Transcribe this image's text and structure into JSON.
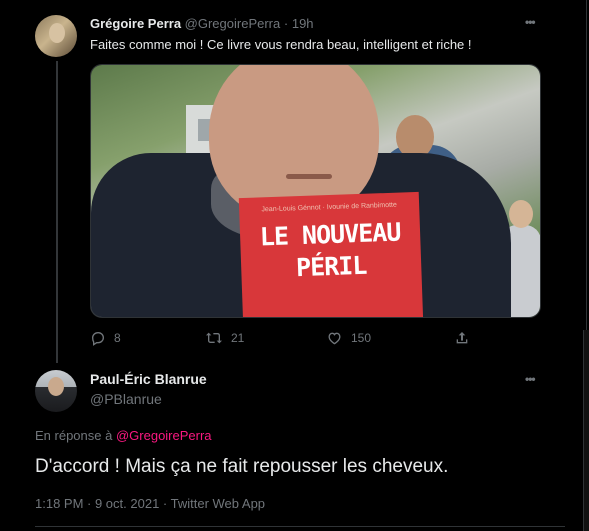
{
  "tweet1": {
    "author_name": "Grégoire Perra",
    "author_handle": "@GregoirePerra",
    "separator": "·",
    "time": "19h",
    "text": "Faites comme moi ! Ce livre vous rendra beau, intelligent et riche !",
    "media": {
      "book_authors": "Jean-Louis Génnot · Ivounie de Ranbimotte",
      "book_title": "LE NOUVEAU\nPÉRIL"
    },
    "actions": {
      "replies": "8",
      "retweets": "21",
      "likes": "150"
    }
  },
  "tweet2": {
    "author_name": "Paul-Éric Blanrue",
    "author_handle": "@PBlanrue",
    "reply_prefix": "En réponse à",
    "reply_to": "@GregoirePerra",
    "text": "D'accord ! Mais ça ne fait repousser les cheveux.",
    "meta": "1:18 PM · 9 oct. 2021 · Twitter Web App"
  },
  "icons": [
    "more-icon",
    "reply-icon",
    "retweet-icon",
    "like-icon",
    "share-icon"
  ],
  "colors": {
    "background": "#000000",
    "text": "#e7e9ea",
    "muted": "#71767b",
    "link": "#f91880",
    "divider": "#2f3336"
  }
}
